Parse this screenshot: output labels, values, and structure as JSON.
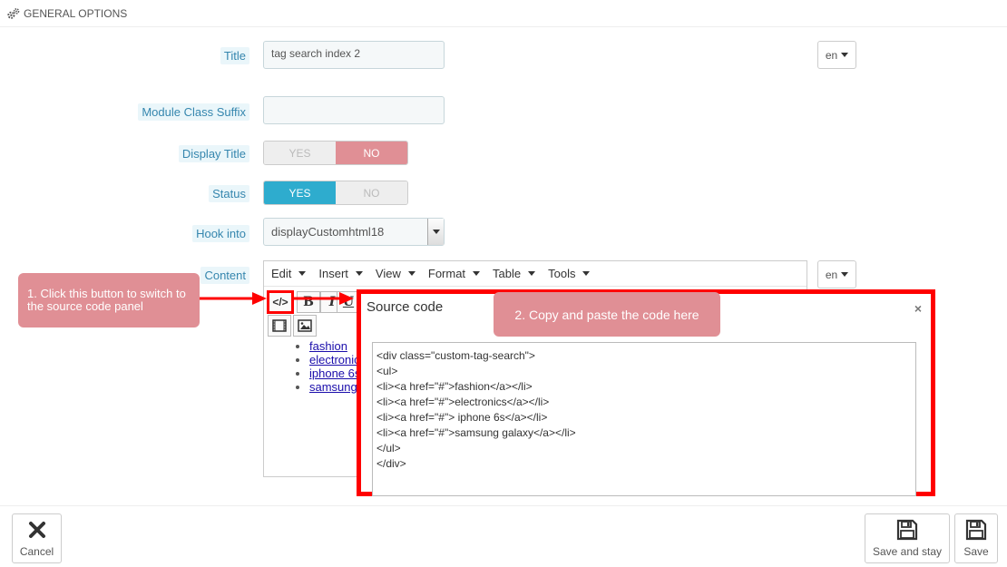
{
  "heading": {
    "title": "GENERAL OPTIONS",
    "icon": "gears-icon"
  },
  "form": {
    "title_label": "Title",
    "title_value": "tag search index 2",
    "lang": "en",
    "suffix_label": "Module Class Suffix",
    "suffix_value": "",
    "display_title_label": "Display Title",
    "display_title_yes": "YES",
    "display_title_no": "NO",
    "status_label": "Status",
    "status_yes": "YES",
    "status_no": "NO",
    "hook_label": "Hook into",
    "hook_value": "displayCustomhtml18",
    "content_label": "Content"
  },
  "editor": {
    "menu": [
      "Edit",
      "Insert",
      "View",
      "Format",
      "Table",
      "Tools"
    ],
    "bold": "B",
    "italic": "I",
    "underline": "U",
    "links": [
      "fashion",
      "electronic",
      "iphone 6s",
      "samsung"
    ]
  },
  "callouts": {
    "step1": "1. Click this button to switch to the source code panel",
    "step2": "2. Copy and paste the code here"
  },
  "modal": {
    "title": "Source code",
    "close": "×",
    "code": "<div class=\"custom-tag-search\">\n<ul>\n<li><a href=\"#\">fashion</a></li>\n<li><a href=\"#\">electronics</a></li>\n<li><a href=\"#\"> iphone 6s</a></li>\n<li><a href=\"#\">samsung galaxy</a></li>\n</ul>\n</div>"
  },
  "footer": {
    "cancel": "Cancel",
    "save_and_stay": "Save and stay",
    "save": "Save"
  },
  "colors": {
    "accent_red": "#e08f95",
    "accent_blue": "#2eacce",
    "highlight": "#ff0000",
    "label_bg": "#eaf6fa",
    "label_text": "#3586ae"
  }
}
